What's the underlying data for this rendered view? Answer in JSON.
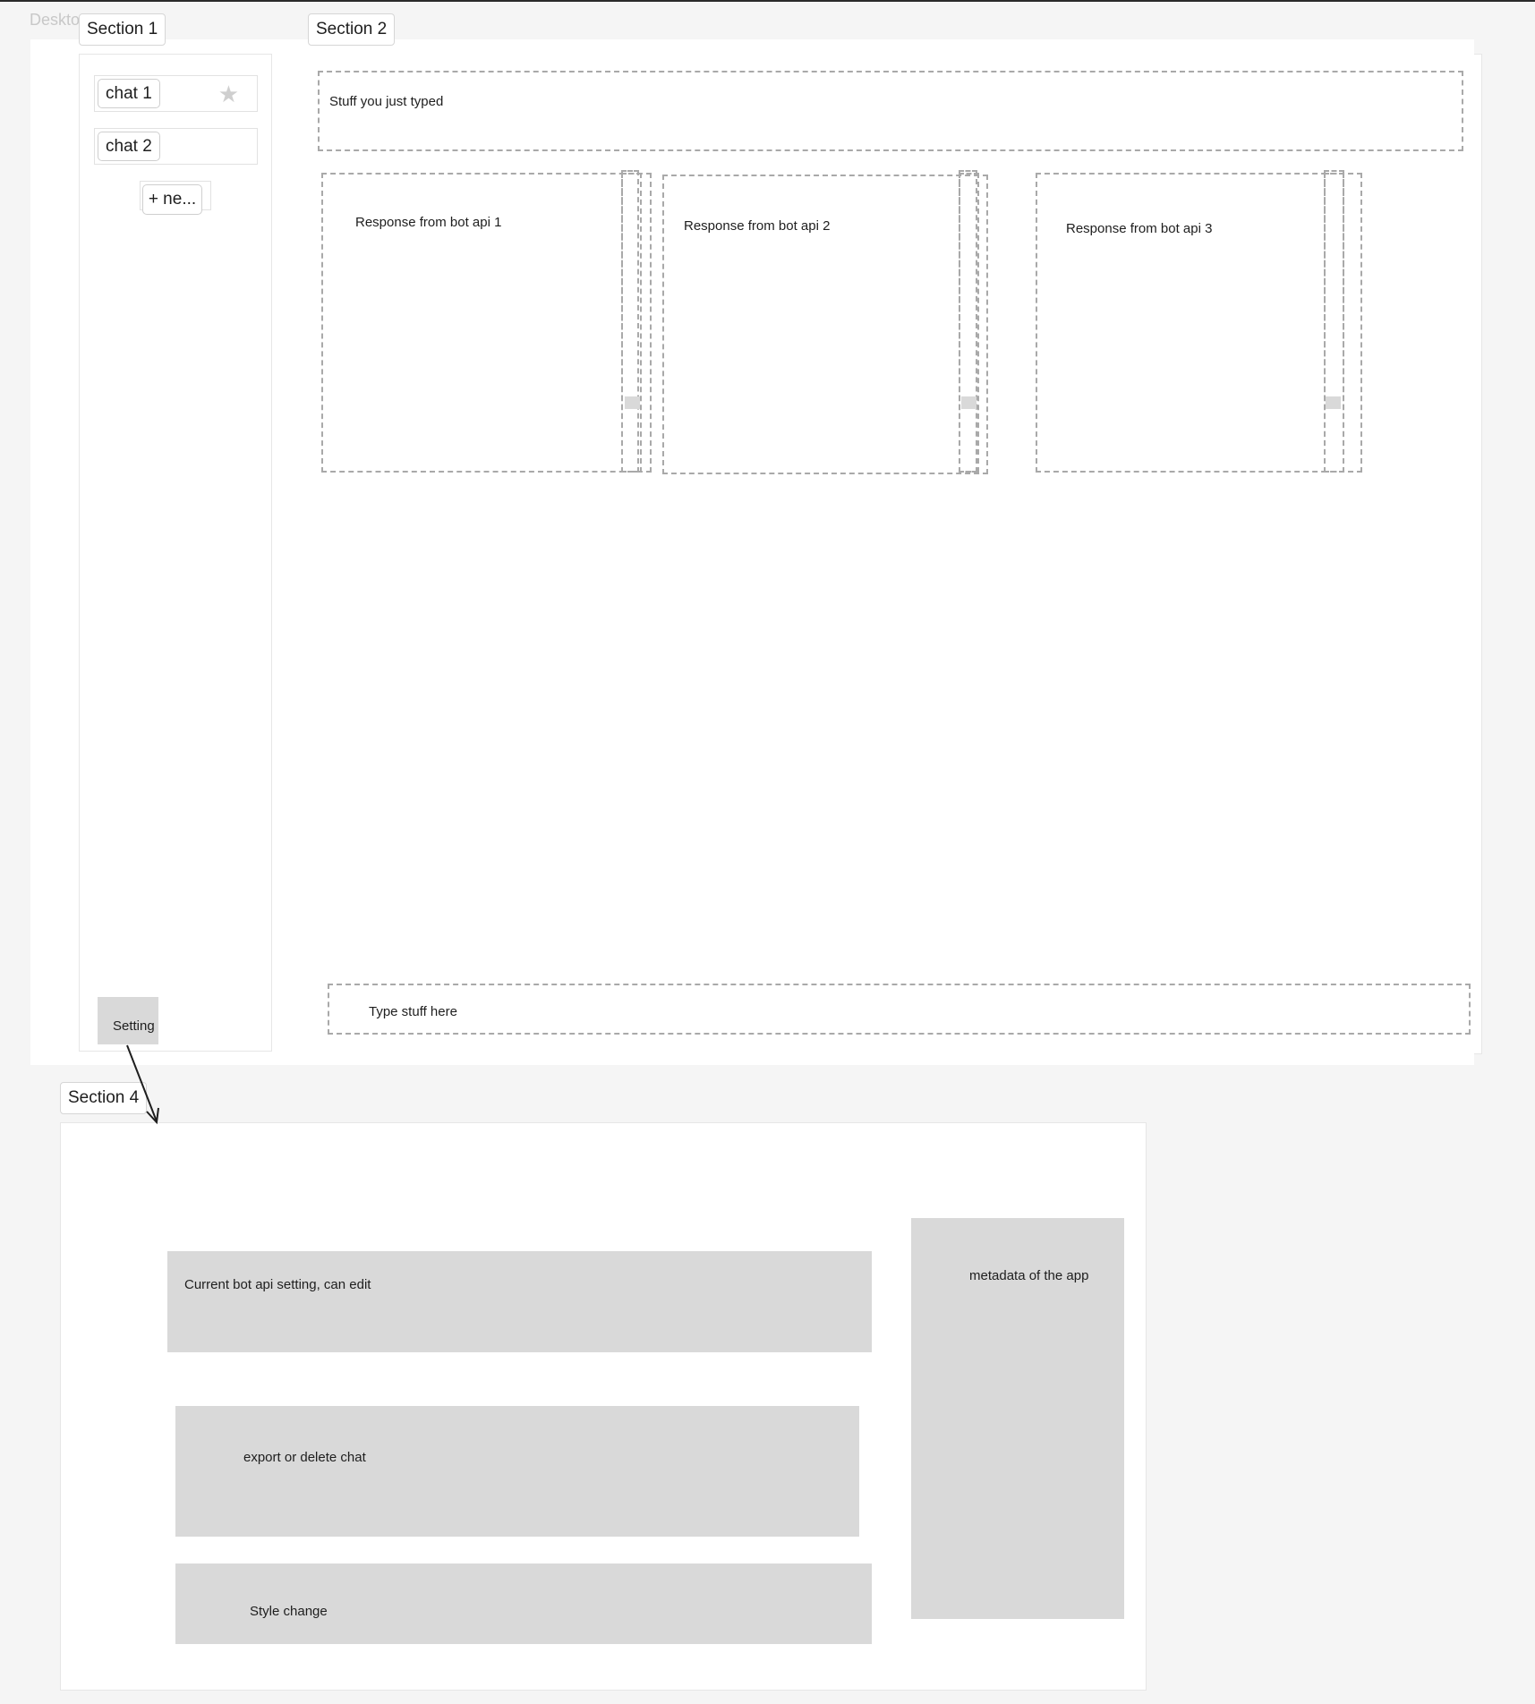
{
  "frame": {
    "label": "Deskto"
  },
  "sections": {
    "s1": "Section 1",
    "s2": "Section 2",
    "s4": "Section 4"
  },
  "sidebar": {
    "chats": [
      "chat 1",
      "chat 2"
    ],
    "new_label": "+ ne...",
    "setting_label": "Setting"
  },
  "main": {
    "typed": "Stuff you just typed",
    "responses": [
      "Response from bot api 1",
      "Response from bot api 2",
      "Response from bot api 3"
    ],
    "input_placeholder": "Type stuff here"
  },
  "settings_panel": {
    "bot_setting": "Current bot api setting, can edit",
    "export_delete": "export or delete chat",
    "style": "Style change",
    "metadata": "metadata of the  app"
  },
  "colors": {
    "grey_fill": "#d9d9d9",
    "dash": "#a9a9a9",
    "canvas": "#f5f5f5"
  },
  "icons": [
    "star-icon",
    "arrow-connector"
  ]
}
